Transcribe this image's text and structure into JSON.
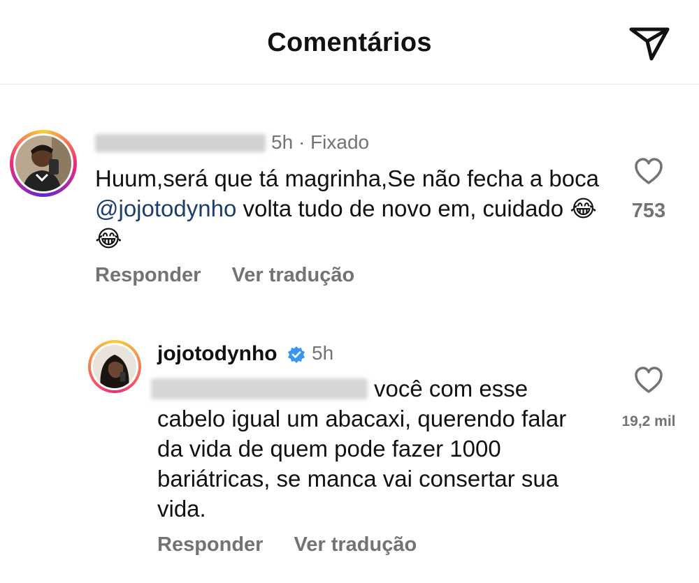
{
  "header": {
    "title": "Comentários"
  },
  "comment": {
    "time": "5h",
    "pinned": "· Fixado",
    "text_before": "Huum,será que tá magrinha,Se não fecha a boca ",
    "mention": "@jojotodynho",
    "text_after": " volta tudo de novo em, cuidado 😂😂",
    "likes": "753",
    "reply_label": "Responder",
    "translate_label": "Ver tradução"
  },
  "reply": {
    "username": "jojotodynho",
    "time": "5h",
    "text": "você com esse cabelo igual um abacaxi, querendo falar da vida de quem pode fazer 1000 bariátricas, se manca vai consertar sua vida.",
    "likes": "19,2 mil",
    "reply_label": "Responder",
    "translate_label": "Ver tradução"
  },
  "icons": {
    "send": "send-icon",
    "heart": "heart-icon",
    "verified": "verified-badge-icon"
  },
  "colors": {
    "mention": "#1c3d6e",
    "muted": "#737373",
    "verified": "#3797f0"
  }
}
